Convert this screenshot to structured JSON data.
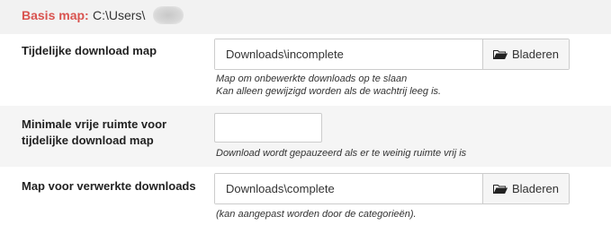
{
  "base": {
    "label": "Basis map:",
    "value": "C:\\Users\\"
  },
  "temp_folder": {
    "label": "Tijdelijke download map",
    "value": "Downloads\\incomplete",
    "browse_label": "Bladeren",
    "help_line1": "Map om onbewerkte downloads op te slaan",
    "help_line2": "Kan alleen gewijzigd worden als de wachtrij leeg is."
  },
  "min_space": {
    "label_line1": "Minimale vrije ruimte voor",
    "label_line2": "tijdelijke download map",
    "value": "",
    "help": "Download wordt gepauzeerd als er te weinig ruimte vrij is"
  },
  "complete_folder": {
    "label": "Map voor verwerkte downloads",
    "value": "Downloads\\complete",
    "browse_label": "Bladeren",
    "help": "(kan aangepast worden door de categorieën)."
  },
  "icons": {
    "browse": "folder-open-icon"
  },
  "colors": {
    "base_label": "#d9534f",
    "alt_row_bg": "#f5f5f5"
  }
}
